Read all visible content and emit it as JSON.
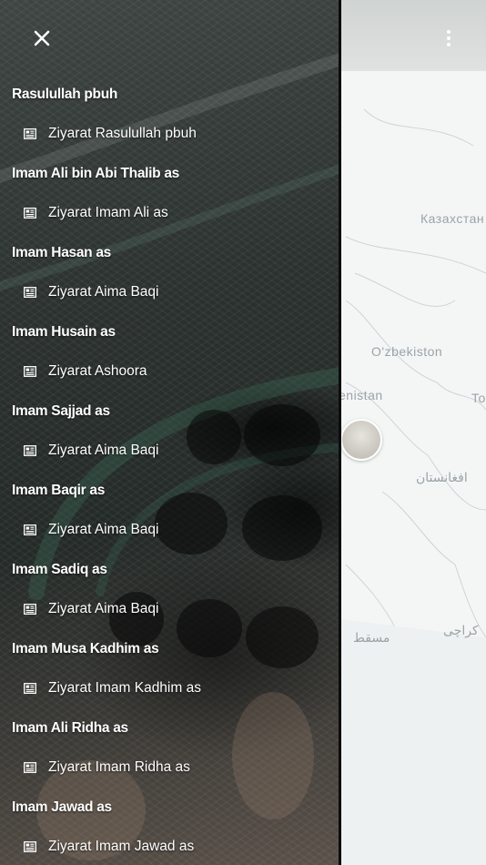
{
  "drawer": {
    "close_icon": "close-icon",
    "sections": [
      {
        "title": "Rasulullah pbuh",
        "item": "Ziyarat Rasulullah pbuh"
      },
      {
        "title": "Imam Ali bin Abi Thalib as",
        "item": "Ziyarat Imam Ali as"
      },
      {
        "title": "Imam Hasan as",
        "item": "Ziyarat Aima Baqi"
      },
      {
        "title": "Imam Husain as",
        "item": "Ziyarat Ashoora"
      },
      {
        "title": "Imam Sajjad as",
        "item": "Ziyarat Aima Baqi"
      },
      {
        "title": "Imam Baqir as",
        "item": "Ziyarat Aima Baqi"
      },
      {
        "title": "Imam Sadiq as",
        "item": "Ziyarat Aima Baqi"
      },
      {
        "title": "Imam Musa Kadhim as",
        "item": "Ziyarat Imam Kadhim as"
      },
      {
        "title": "Imam Ali Ridha as",
        "item": "Ziyarat Imam Ridha as"
      },
      {
        "title": "Imam Jawad as",
        "item": "Ziyarat Imam Jawad as"
      }
    ],
    "item_icon": "newspaper-icon"
  },
  "map": {
    "labels": {
      "kazakhstan": "Казахстан",
      "uzbekistan": "O'zbekiston",
      "turkmenistan": "enistan",
      "tajikistan": "To",
      "afghanistan": "افغانستان",
      "muscat": "مسقط",
      "karachi": "کراچی"
    },
    "overflow_icon": "more-vert-icon",
    "marker_icon": "location-marker"
  },
  "colors": {
    "drawer_text": "#ffffff",
    "map_background": "#f4f6f6",
    "map_label": "#9aa3a8"
  }
}
